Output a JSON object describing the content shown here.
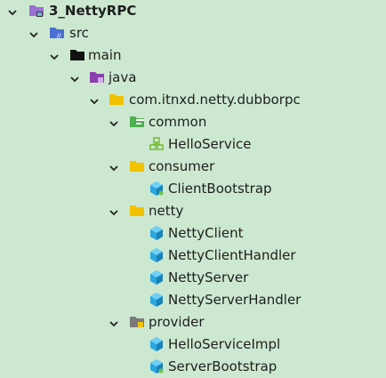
{
  "tree": {
    "nodes": [
      {
        "label": "3_NettyRPC",
        "kind": "module",
        "expanded": true
      },
      {
        "label": "src",
        "kind": "source-folder",
        "expanded": true
      },
      {
        "label": "main",
        "kind": "folder",
        "expanded": true
      },
      {
        "label": "java",
        "kind": "java-root",
        "expanded": true
      },
      {
        "label": "com.itnxd.netty.dubborpc",
        "kind": "package",
        "expanded": true
      },
      {
        "label": "common",
        "kind": "package-common",
        "expanded": true
      },
      {
        "label": "HelloService",
        "kind": "interface"
      },
      {
        "label": "consumer",
        "kind": "package",
        "expanded": true
      },
      {
        "label": "ClientBootstrap",
        "kind": "class"
      },
      {
        "label": "netty",
        "kind": "package",
        "expanded": true
      },
      {
        "label": "NettyClient",
        "kind": "class"
      },
      {
        "label": "NettyClientHandler",
        "kind": "class"
      },
      {
        "label": "NettyServer",
        "kind": "class"
      },
      {
        "label": "NettyServerHandler",
        "kind": "class"
      },
      {
        "label": "provider",
        "kind": "package-provider",
        "expanded": true
      },
      {
        "label": "HelloServiceImpl",
        "kind": "class"
      },
      {
        "label": "ServerBootstrap",
        "kind": "class"
      }
    ]
  },
  "colors": {
    "background": "#cde8d0",
    "text": "#1e1e1e",
    "module": "#9b6fd0",
    "source_folder": "#4a6fd3",
    "folder": "#111111",
    "java_root": "#8a3fb0",
    "package": "#f2c200",
    "package_common": "#4caf50",
    "package_provider": "#7a7a7a",
    "class": "#2aa6e0",
    "interface": "#7bbf3a"
  }
}
